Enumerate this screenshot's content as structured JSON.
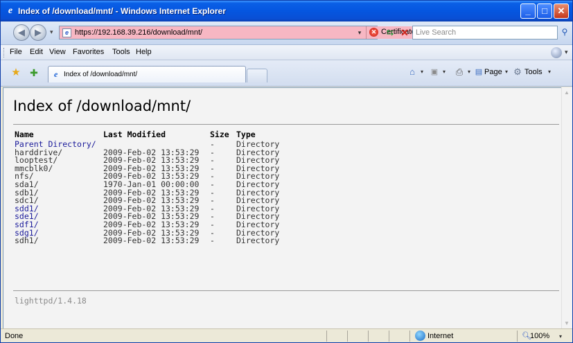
{
  "window": {
    "title": "Index of /download/mnt/ - Windows Internet Explorer"
  },
  "address_bar": {
    "url": "https://192.168.39.216/download/mnt/",
    "certificate_label": "Certificate Error",
    "search_placeholder": "Live Search"
  },
  "menu": [
    "File",
    "Edit",
    "View",
    "Favorites",
    "Tools",
    "Help"
  ],
  "tab": {
    "label": "Index of /download/mnt/"
  },
  "command_bar": {
    "page_label": "Page",
    "tools_label": "Tools"
  },
  "page": {
    "heading": "Index of /download/mnt/",
    "columns": {
      "name": "Name",
      "modified": "Last Modified",
      "size": "Size",
      "type": "Type"
    },
    "rows": [
      {
        "name": "Parent Directory/",
        "modified": "",
        "size": "-",
        "type": "Directory",
        "style": "link"
      },
      {
        "name": "harddrive/",
        "modified": "2009-Feb-02 13:53:29",
        "size": "-",
        "type": "Directory",
        "style": "plain"
      },
      {
        "name": "looptest/",
        "modified": "2009-Feb-02 13:53:29",
        "size": "-",
        "type": "Directory",
        "style": "plain"
      },
      {
        "name": "mmcblk0/",
        "modified": "2009-Feb-02 13:53:29",
        "size": "-",
        "type": "Directory",
        "style": "plain"
      },
      {
        "name": "nfs/",
        "modified": "2009-Feb-02 13:53:29",
        "size": "-",
        "type": "Directory",
        "style": "plain"
      },
      {
        "name": "sda1/",
        "modified": "1970-Jan-01 00:00:00",
        "size": "-",
        "type": "Directory",
        "style": "plain"
      },
      {
        "name": "sdb1/",
        "modified": "2009-Feb-02 13:53:29",
        "size": "-",
        "type": "Directory",
        "style": "plain"
      },
      {
        "name": "sdc1/",
        "modified": "2009-Feb-02 13:53:29",
        "size": "-",
        "type": "Directory",
        "style": "plain"
      },
      {
        "name": "sdd1/",
        "modified": "2009-Feb-02 13:53:29",
        "size": "-",
        "type": "Directory",
        "style": "link"
      },
      {
        "name": "sde1/",
        "modified": "2009-Feb-02 13:53:29",
        "size": "-",
        "type": "Directory",
        "style": "link"
      },
      {
        "name": "sdf1/",
        "modified": "2009-Feb-02 13:53:29",
        "size": "-",
        "type": "Directory",
        "style": "link"
      },
      {
        "name": "sdg1/",
        "modified": "2009-Feb-02 13:53:29",
        "size": "-",
        "type": "Directory",
        "style": "link"
      },
      {
        "name": "sdh1/",
        "modified": "2009-Feb-02 13:53:29",
        "size": "-",
        "type": "Directory",
        "style": "plain"
      }
    ],
    "footer": "lighttpd/1.4.18"
  },
  "status_bar": {
    "status": "Done",
    "zone": "Internet",
    "zoom": "100%"
  },
  "icons": {
    "back": "back-arrow-icon",
    "forward": "forward-arrow-icon",
    "refresh": "refresh-icon",
    "stop": "stop-icon",
    "search": "search-icon",
    "favorites": "favorites-star-icon",
    "add_favorites": "add-favorites-icon",
    "home": "home-icon",
    "feeds": "feeds-icon",
    "print": "print-icon",
    "page": "page-icon",
    "tools": "tools-gear-icon",
    "internet_zone": "globe-icon",
    "zoom": "magnifier-icon"
  },
  "colors": {
    "title_bar": "#0556e0",
    "address_error": "#f7b7c3",
    "link": "#1a1a9a",
    "page_background": "#f3f3f3"
  }
}
